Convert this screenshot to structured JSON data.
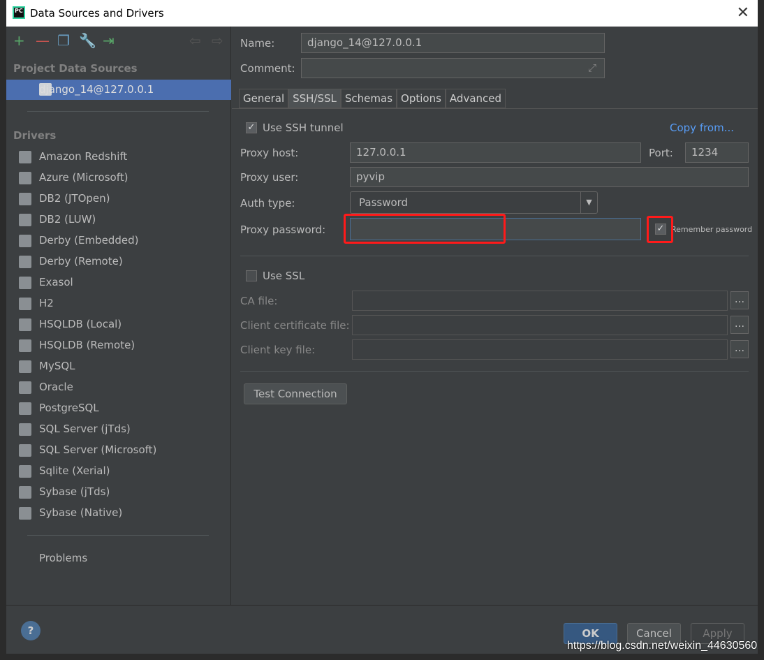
{
  "window": {
    "title": "Data Sources and Drivers",
    "app_icon": "PC"
  },
  "toolbar": {
    "icons": [
      "add-icon",
      "remove-icon",
      "copy-icon",
      "settings-wrench-icon",
      "import-icon",
      "back-arrow-icon",
      "forward-arrow-icon"
    ]
  },
  "sidebar": {
    "project_header": "Project Data Sources",
    "project_items": [
      {
        "label": "django_14@127.0.0.1"
      }
    ],
    "drivers_header": "Drivers",
    "drivers": [
      {
        "label": "Amazon Redshift"
      },
      {
        "label": "Azure (Microsoft)"
      },
      {
        "label": "DB2 (JTOpen)"
      },
      {
        "label": "DB2 (LUW)"
      },
      {
        "label": "Derby (Embedded)"
      },
      {
        "label": "Derby (Remote)"
      },
      {
        "label": "Exasol"
      },
      {
        "label": "H2"
      },
      {
        "label": "HSQLDB (Local)"
      },
      {
        "label": "HSQLDB (Remote)"
      },
      {
        "label": "MySQL"
      },
      {
        "label": "Oracle"
      },
      {
        "label": "PostgreSQL"
      },
      {
        "label": "SQL Server (jTds)"
      },
      {
        "label": "SQL Server (Microsoft)"
      },
      {
        "label": "Sqlite (Xerial)"
      },
      {
        "label": "Sybase (jTds)"
      },
      {
        "label": "Sybase (Native)"
      }
    ],
    "problems": "Problems"
  },
  "form": {
    "name_label": "Name:",
    "name_value": "django_14@127.0.0.1",
    "comment_label": "Comment:",
    "comment_value": "",
    "tabs": [
      {
        "label": "General"
      },
      {
        "label": "SSH/SSL",
        "active": true
      },
      {
        "label": "Schemas"
      },
      {
        "label": "Options"
      },
      {
        "label": "Advanced"
      }
    ],
    "use_ssh_label": "Use SSH tunnel",
    "use_ssh_checked": true,
    "copy_from": "Copy from...",
    "proxy_host_label": "Proxy host:",
    "proxy_host_value": "127.0.0.1",
    "port_label": "Port:",
    "port_value": "1234",
    "proxy_user_label": "Proxy user:",
    "proxy_user_value": "pyvip",
    "auth_type_label": "Auth type:",
    "auth_type_value": "Password",
    "proxy_password_label": "Proxy password:",
    "proxy_password_value": "",
    "remember_password_label": "Remember password",
    "remember_password_checked": true,
    "use_ssl_label": "Use SSL",
    "use_ssl_checked": false,
    "ca_file_label": "CA file:",
    "client_cert_label": "Client certificate file:",
    "client_key_label": "Client key file:",
    "browse_label": "...",
    "test_connection": "Test Connection"
  },
  "footer": {
    "help": "?",
    "ok": "OK",
    "cancel": "Cancel",
    "apply": "Apply"
  },
  "watermark": "https://blog.csdn.net/weixin_44630560",
  "colors": {
    "selection": "#4b6eaf",
    "link": "#589df6",
    "highlight": "#ff1a1a",
    "panel": "#3c3f41"
  }
}
